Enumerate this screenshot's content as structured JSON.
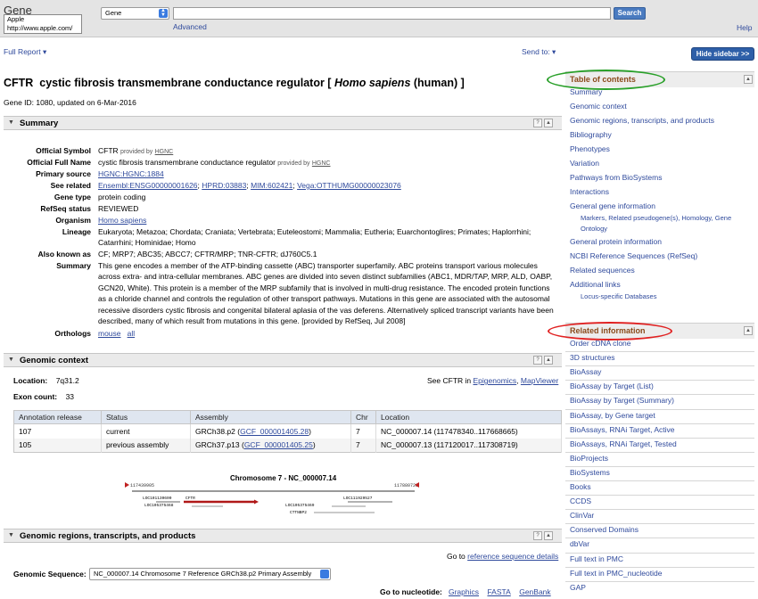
{
  "header": {
    "brand": "Gene",
    "tooltip_line1": "Apple",
    "tooltip_line2": "http://www.apple.com/",
    "db_select": "Gene",
    "search_value": "",
    "search_button": "Search",
    "advanced": "Advanced",
    "help": "Help"
  },
  "menus": {
    "full_report": "Full Report",
    "send_to": "Send to:",
    "hide_sidebar": "Hide sidebar >>"
  },
  "gene": {
    "symbol": "CFTR",
    "name": "cystic fibrosis transmembrane conductance regulator [",
    "organism": "Homo sapiens",
    "organism_suffix": "(human) ]",
    "gene_id_line": "Gene ID: 1080, updated on 6-Mar-2016"
  },
  "summary": {
    "title": "Summary",
    "labels": [
      "Official Symbol",
      "Official Full Name",
      "Primary source",
      "See related",
      "Gene type",
      "RefSeq status",
      "Organism",
      "Lineage",
      "Also known as",
      "Summary",
      "Orthologs"
    ],
    "official_symbol": "CFTR",
    "provided_by": "provided by",
    "hgnc": "HGNC",
    "official_full_name": "cystic fibrosis transmembrane conductance regulator",
    "primary_source": "HGNC:HGNC:1884",
    "see_related": [
      "Ensembl:ENSG00000001626",
      "HPRD:03883",
      "MIM:602421",
      "Vega:OTTHUMG00000023076"
    ],
    "gene_type": "protein coding",
    "refseq_status": "REVIEWED",
    "organism": "Homo sapiens",
    "lineage": "Eukaryota; Metazoa; Chordata; Craniata; Vertebrata; Euteleostomi; Mammalia; Eutheria; Euarchontoglires; Primates; Haplorrhini; Catarrhini; Hominidae; Homo",
    "also_known_as": "CF; MRP7; ABC35; ABCC7; CFTR/MRP; TNR-CFTR; dJ760C5.1",
    "summary_text": "This gene encodes a member of the ATP-binding cassette (ABC) transporter superfamily. ABC proteins transport various molecules across extra- and intra-cellular membranes. ABC genes are divided into seven distinct subfamilies (ABC1, MDR/TAP, MRP, ALD, OABP, GCN20, White). This protein is a member of the MRP subfamily that is involved in multi-drug resistance. The encoded protein functions as a chloride channel and controls the regulation of other transport pathways. Mutations in this gene are associated with the autosomal recessive disorders cystic fibrosis and congenital bilateral aplasia of the vas deferens. Alternatively spliced transcript variants have been described, many of which result from mutations in this gene. [provided by RefSeq, Jul 2008]",
    "orthologs": [
      "mouse",
      "all"
    ]
  },
  "genomic_context": {
    "title": "Genomic context",
    "location_label": "Location:",
    "location": "7q31.2",
    "exon_label": "Exon count:",
    "exon_count": "33",
    "see_cftr": "See CFTR in",
    "epigenomics": "Epigenomics",
    "mapviewer": "MapViewer",
    "columns": [
      "Annotation release",
      "Status",
      "Assembly",
      "Chr",
      "Location"
    ],
    "rows": [
      {
        "release": "107",
        "status": "current",
        "assembly": "GRCh38.p2 (",
        "gcf": "GCF_000001405.28",
        "close": ")",
        "chr": "7",
        "location": "NC_000007.14 (117478340..117668665)"
      },
      {
        "release": "105",
        "status": "previous assembly",
        "assembly": "GRCh37.p13 (",
        "gcf": "GCF_000001405.25",
        "close": ")",
        "chr": "7",
        "location": "NC_000007.13 (117120017..117308719)"
      }
    ],
    "chromo_title": "Chromosome 7 - NC_000007.14",
    "left_coord": "117439905",
    "right_coord": "117880723",
    "genes": [
      "LOC101130600",
      "CFTR",
      "LOC111929527",
      "LOC105375468",
      "LOC105375469",
      "CTTNBP2"
    ]
  },
  "genomic_regions": {
    "title": "Genomic regions, transcripts, and products",
    "goto": "Go to",
    "ref_details": "reference sequence details",
    "gseq_label": "Genomic Sequence:",
    "gseq_value": "NC_000007.14 Chromosome 7 Reference GRCh38.p2 Primary Assembly",
    "goto_nuc": "Go to nucleotide:",
    "nuc_links": [
      "Graphics",
      "FASTA",
      "GenBank"
    ]
  },
  "sidebar": {
    "toc_title": "Table of contents",
    "toc_items": [
      "Summary",
      "Genomic context",
      "Genomic regions, transcripts, and products",
      "Bibliography",
      "Phenotypes",
      "Variation",
      "Pathways from BioSystems",
      "Interactions",
      "General gene information"
    ],
    "ggi_sub": "Markers, Related pseudogene(s), Homology, Gene Ontology",
    "toc_items2": [
      "General protein information",
      "NCBI Reference Sequences (RefSeq)",
      "Related sequences",
      "Additional links"
    ],
    "additional_sub": "Locus-specific Databases",
    "related_title": "Related information",
    "related_items": [
      "Order cDNA clone",
      "3D structures",
      "BioAssay",
      "BioAssay by Target (List)",
      "BioAssay by Target (Summary)",
      "BioAssay, by Gene target",
      "BioAssays, RNAi Target, Active",
      "BioAssays, RNAi Target, Tested",
      "BioProjects",
      "BioSystems",
      "Books",
      "CCDS",
      "ClinVar",
      "Conserved Domains",
      "dbVar",
      "Full text in PMC",
      "Full text in PMC_nucleotide",
      "GAP"
    ]
  },
  "colors": {
    "link": "#2f4a9c",
    "toc_highlight": "#2aa02a",
    "related_highlight": "#e02020",
    "header_text": "#8a4a1a"
  }
}
